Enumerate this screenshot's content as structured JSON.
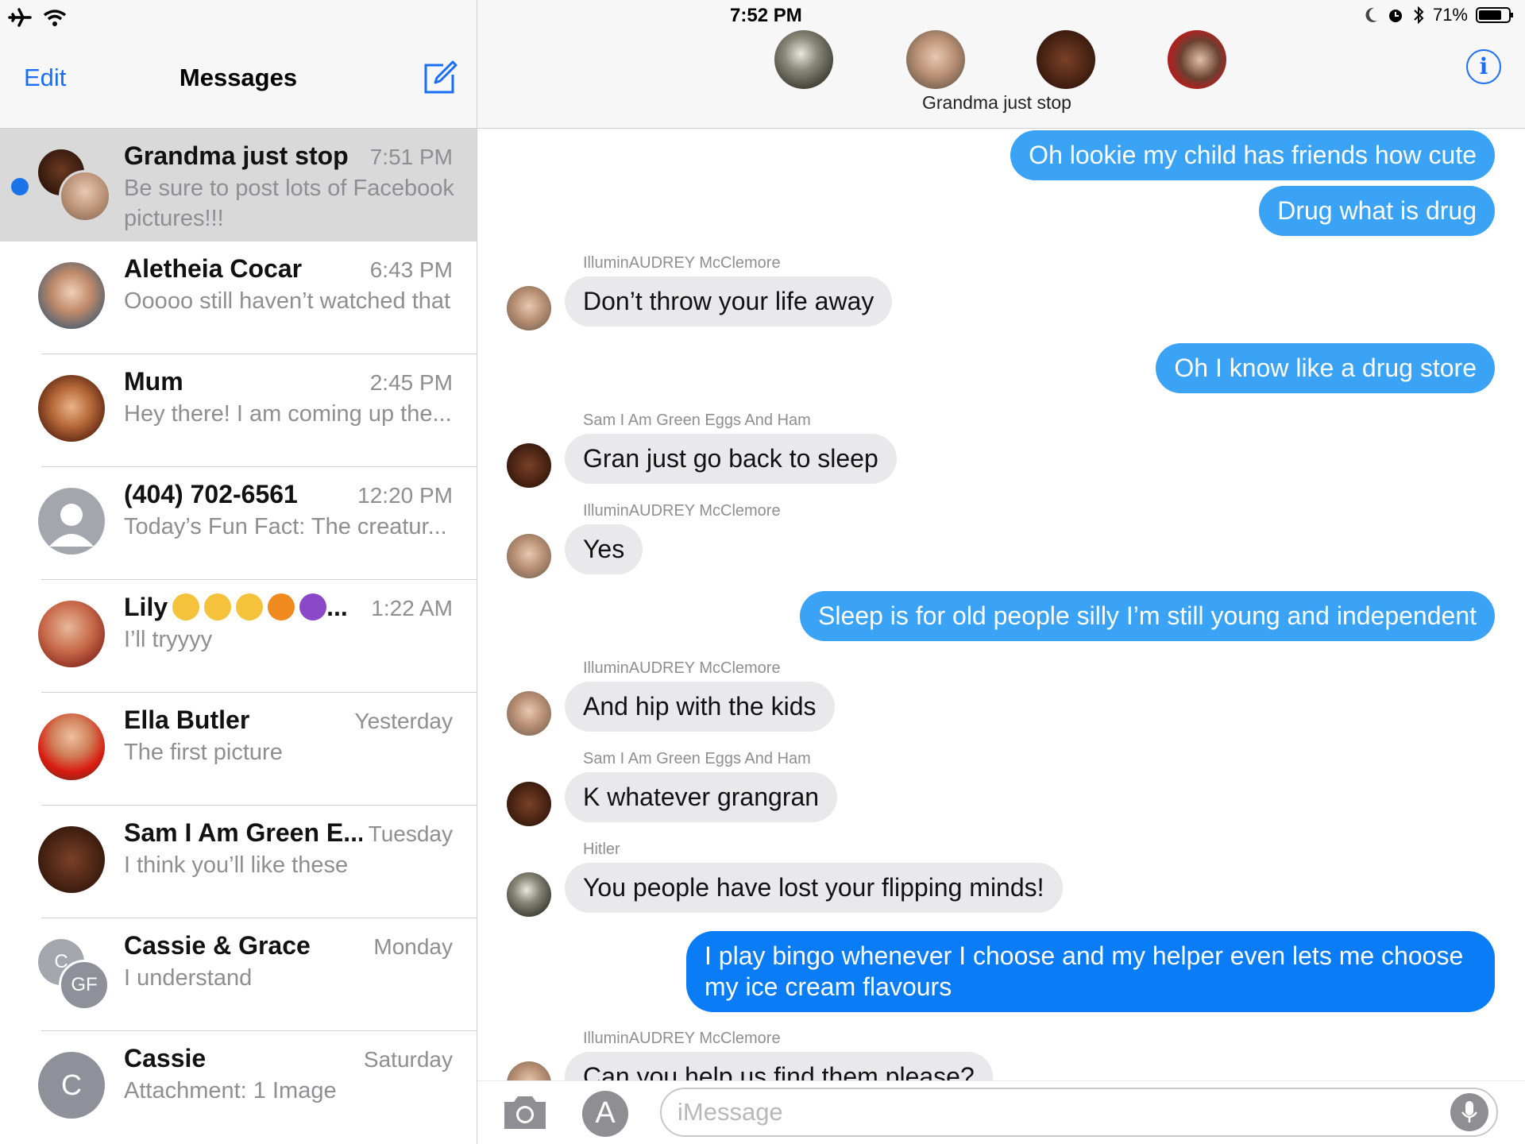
{
  "status_bar": {
    "time": "7:52 PM",
    "battery": "71%",
    "icons": [
      "airplane-icon",
      "wifi-icon",
      "moon-icon",
      "alarm-icon",
      "bluetooth-icon",
      "battery-icon"
    ]
  },
  "sidebar": {
    "edit_label": "Edit",
    "title": "Messages",
    "compose_icon": "compose-icon",
    "conversations": [
      {
        "name": "Grandma just stop",
        "time": "7:51 PM",
        "preview": "Be sure to post lots of Facebook pictures!!!",
        "unread": true,
        "selected": true,
        "avatar": "group-photo"
      },
      {
        "name": "Aletheia Cocar",
        "time": "6:43 PM",
        "preview": "Ooooo still haven’t watched that",
        "avatar": "photo"
      },
      {
        "name": "Mum",
        "time": "2:45 PM",
        "preview": "Hey there! I am coming up the...",
        "avatar": "photo"
      },
      {
        "name": "(404) 702-6561",
        "time": "12:20 PM",
        "preview": "Today’s Fun Fact: The creatur...",
        "avatar": "person-icon"
      },
      {
        "name": "Lily",
        "name_suffix": "...",
        "time": "1:22 AM",
        "preview": "I’ll tryyyy",
        "avatar": "photo",
        "emojis": [
          "squinting-face",
          "tongue-face",
          "sunglasses-face",
          "jack-o-lantern",
          "smiling-devil"
        ]
      },
      {
        "name": "Ella Butler",
        "time": "Yesterday",
        "preview": "The first picture",
        "avatar": "photo"
      },
      {
        "name": "Sam I Am Green E...",
        "time": "Tuesday",
        "preview": "I think you’ll like these",
        "avatar": "photo"
      },
      {
        "name": "Cassie & Grace",
        "time": "Monday",
        "preview": "I understand",
        "avatar": "initials",
        "initials": [
          "C",
          "GF"
        ]
      },
      {
        "name": "Cassie",
        "time": "Saturday",
        "preview": "Attachment: 1 Image",
        "avatar": "initials",
        "initials": [
          "C"
        ]
      }
    ]
  },
  "conversation": {
    "group_name": "Grandma just stop",
    "info_icon": "info-icon",
    "messages": [
      {
        "direction": "out",
        "text": "Oh lookie my child has friends how cute"
      },
      {
        "direction": "out",
        "text": "Drug what is drug"
      },
      {
        "direction": "in",
        "sender": "IlluminAUDREY McClemore",
        "text": "Don’t throw your life away"
      },
      {
        "direction": "out",
        "text": "Oh I know like a drug store"
      },
      {
        "direction": "in",
        "sender": "Sam I Am Green Eggs And Ham",
        "text": "Gran just go back to sleep"
      },
      {
        "direction": "in",
        "sender": "IlluminAUDREY McClemore",
        "text": "Yes"
      },
      {
        "direction": "out",
        "text": "Sleep is for old people silly I’m still young and independent"
      },
      {
        "direction": "in",
        "sender": "IlluminAUDREY McClemore",
        "text": "And hip with the kids"
      },
      {
        "direction": "in",
        "sender": "Sam I Am Green Eggs And Ham",
        "text": "K whatever grangran"
      },
      {
        "direction": "in",
        "sender": "Hitler",
        "text": "You people have lost your flipping minds!"
      },
      {
        "direction": "out",
        "text": "I play bingo whenever I choose and my helper even lets me choose my ice cream flavours"
      },
      {
        "direction": "in",
        "sender": "IlluminAUDREY McClemore",
        "text": "Can you help us find them please?"
      }
    ]
  },
  "input_bar": {
    "placeholder": "iMessage",
    "camera_icon": "camera-icon",
    "apps_icon": "app-store-icon",
    "mic_icon": "microphone-icon"
  },
  "colors": {
    "accent": "#1a6ef5",
    "outgoing_bubble": "#3aa3f5",
    "incoming_bubble": "#e9e9eb",
    "unread_dot": "#1a73e8"
  }
}
